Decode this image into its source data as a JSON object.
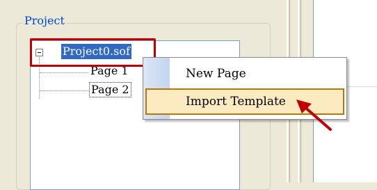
{
  "project_panel": {
    "group_title": "Project",
    "tree": {
      "root_label": "Project0.sof",
      "pages": [
        "Page 1",
        "Page 2"
      ]
    }
  },
  "context_menu": {
    "items": [
      {
        "label": "New Page",
        "highlighted": false
      },
      {
        "label": "Import Template",
        "highlighted": true
      }
    ]
  },
  "colors": {
    "selection": "#316ac5",
    "callout_red": "#c00000",
    "menu_hover": "#fcebc1",
    "group_title": "#0046d5"
  }
}
